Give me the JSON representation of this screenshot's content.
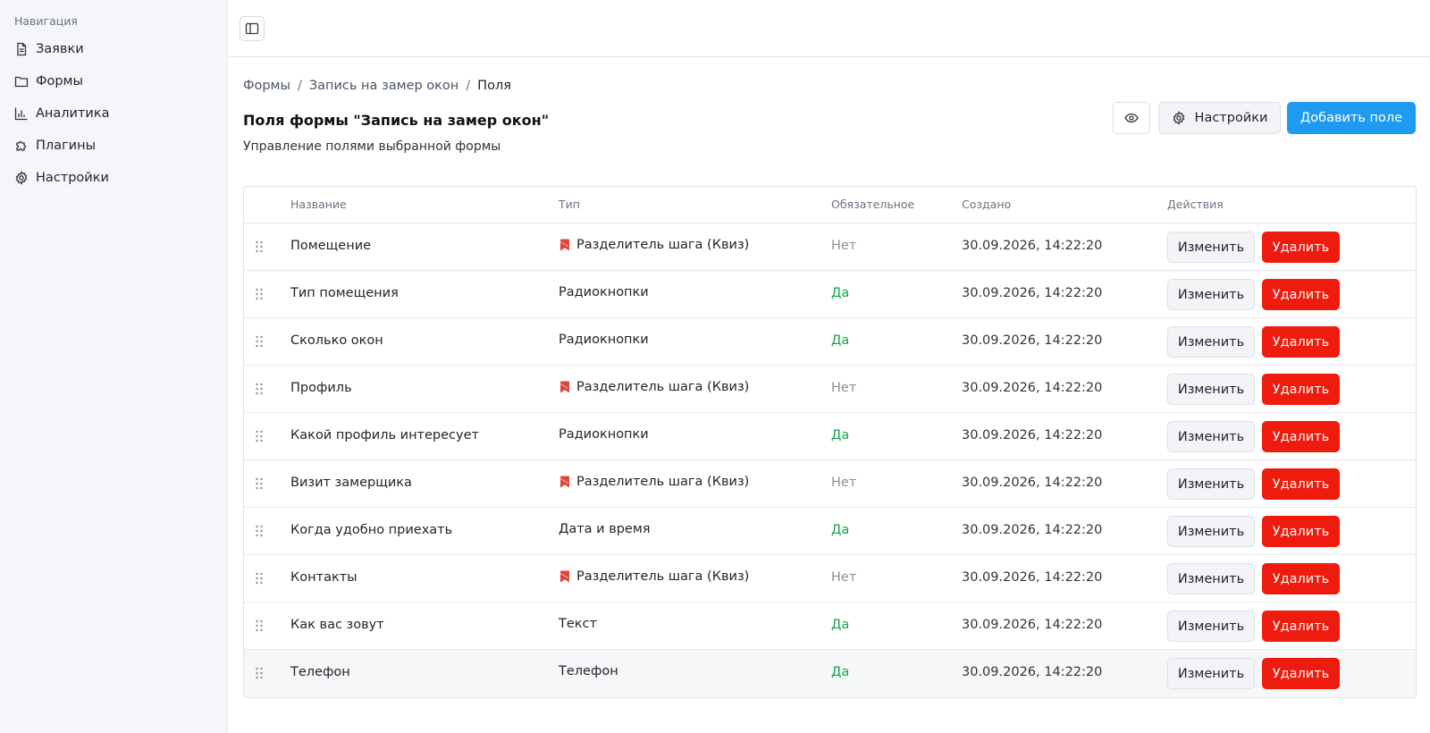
{
  "sidebar": {
    "heading": "Навигация",
    "items": [
      {
        "label": "Заявки",
        "icon": "file-text-icon"
      },
      {
        "label": "Формы",
        "icon": "folder-icon"
      },
      {
        "label": "Аналитика",
        "icon": "bar-chart-icon"
      },
      {
        "label": "Плагины",
        "icon": "puzzle-icon"
      },
      {
        "label": "Настройки",
        "icon": "gear-icon"
      }
    ]
  },
  "breadcrumb": {
    "items": [
      "Формы",
      "Запись на замер окон",
      "Поля"
    ],
    "separator": "/"
  },
  "page": {
    "title": "Поля формы \"Запись на замер окон\"",
    "subtitle": "Управление полями выбранной формы"
  },
  "toolbar": {
    "preview_icon": "eye-icon",
    "settings_label": "Настройки",
    "add_label": "Добавить поле"
  },
  "colors": {
    "primary": "#1e9bf0",
    "danger": "#ee1c0e",
    "success": "#16a34a",
    "muted": "#8b8f96"
  },
  "table": {
    "headers": [
      "Название",
      "Тип",
      "Обязательное",
      "Создано",
      "Действия"
    ],
    "edit_label": "Изменить",
    "delete_label": "Удалить",
    "rows": [
      {
        "name": "Помещение",
        "type": "Разделитель шага (Квиз)",
        "step": true,
        "required": "Нет",
        "created": "30.09.2026, 14:22:20"
      },
      {
        "name": "Тип помещения",
        "type": "Радиокнопки",
        "step": false,
        "required": "Да",
        "created": "30.09.2026, 14:22:20"
      },
      {
        "name": "Сколько окон",
        "type": "Радиокнопки",
        "step": false,
        "required": "Да",
        "created": "30.09.2026, 14:22:20"
      },
      {
        "name": "Профиль",
        "type": "Разделитель шага (Квиз)",
        "step": true,
        "required": "Нет",
        "created": "30.09.2026, 14:22:20"
      },
      {
        "name": "Какой профиль интересует",
        "type": "Радиокнопки",
        "step": false,
        "required": "Да",
        "created": "30.09.2026, 14:22:20"
      },
      {
        "name": "Визит замерщика",
        "type": "Разделитель шага (Квиз)",
        "step": true,
        "required": "Нет",
        "created": "30.09.2026, 14:22:20"
      },
      {
        "name": "Когда удобно приехать",
        "type": "Дата и время",
        "step": false,
        "required": "Да",
        "created": "30.09.2026, 14:22:20"
      },
      {
        "name": "Контакты",
        "type": "Разделитель шага (Квиз)",
        "step": true,
        "required": "Нет",
        "created": "30.09.2026, 14:22:20"
      },
      {
        "name": "Как вас зовут",
        "type": "Текст",
        "step": false,
        "required": "Да",
        "created": "30.09.2026, 14:22:20"
      },
      {
        "name": "Телефон",
        "type": "Телефон",
        "step": false,
        "required": "Да",
        "created": "30.09.2026, 14:22:20"
      }
    ]
  }
}
